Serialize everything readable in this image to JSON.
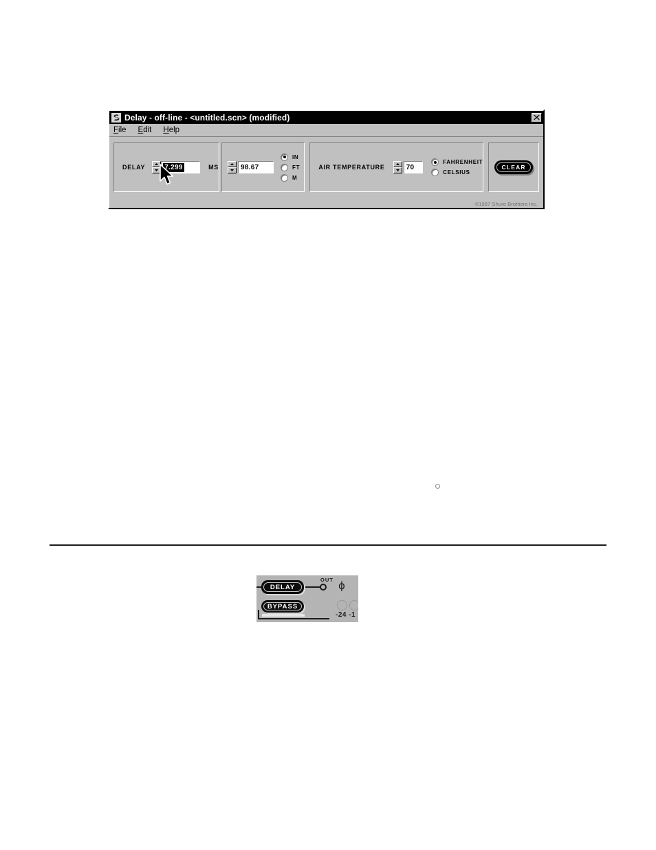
{
  "delay_window": {
    "titlebar": {
      "logo_icon": "shure-s-logo-icon",
      "title": "Delay - off-line - <untitled.scn> (modified)",
      "close_icon": "close-x-icon",
      "title_bg": "#000000",
      "title_fg": "#ffffff"
    },
    "menubar": {
      "items": [
        {
          "label": "File",
          "mnemonic": "F",
          "rest": "ile"
        },
        {
          "label": "Edit",
          "mnemonic": "E",
          "rest": "dit"
        },
        {
          "label": "Help",
          "mnemonic": "H",
          "rest": "elp"
        }
      ]
    },
    "delay_group": {
      "label": "DELAY",
      "value": "7.299",
      "value_selected": true,
      "units_label": "MS",
      "spinner_up_icon": "spinner-up-arrow-icon",
      "spinner_down_icon": "spinner-down-arrow-icon"
    },
    "distance_group": {
      "value": "98.67",
      "spinner_up_icon": "spinner-up-arrow-icon",
      "spinner_down_icon": "spinner-down-arrow-icon",
      "unit_options": [
        {
          "label": "IN",
          "selected": true
        },
        {
          "label": "FT",
          "selected": false
        },
        {
          "label": "M",
          "selected": false
        }
      ]
    },
    "temperature_group": {
      "label": "AIR TEMPERATURE",
      "value": "70",
      "spinner_up_icon": "spinner-up-arrow-icon",
      "spinner_down_icon": "spinner-down-arrow-icon",
      "scale_options": [
        {
          "label": "FAHRENHEIT",
          "selected": true
        },
        {
          "label": "CELSIUS",
          "selected": false
        }
      ]
    },
    "clear_group": {
      "button_label": "CLEAR"
    },
    "copyright": "©1997 Shure Brothers Inc.",
    "cursor_icon": "mouse-pointer-arrow-icon",
    "colors": {
      "window_face": "#c0c0c0",
      "field_bg": "#ffffff",
      "selection_bg": "#000000",
      "button_black": "#000000"
    }
  },
  "panel_crop": {
    "buttons": [
      {
        "label": "DELAY"
      },
      {
        "label": "BYPASS"
      }
    ],
    "out_label": "OUT",
    "out_jack_icon": "output-jack-icon",
    "phase_symbol": "ɸ",
    "scale_label": "-24 -1",
    "knob_icon": "rotary-knob-icon",
    "colors": {
      "panel_bg": "#b4b4b4",
      "button_black": "#0d0d0d"
    }
  },
  "page": {
    "degree_mark_icon": "degree-symbol-mark",
    "rule_color": "#1a1a1a"
  }
}
